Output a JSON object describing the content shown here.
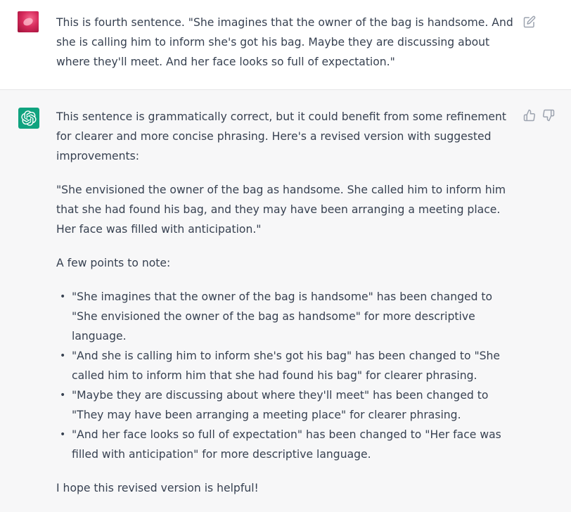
{
  "user_message": {
    "text": "This is fourth sentence. \"She imagines that the owner of the bag is handsome. And she is calling him to inform she's got his bag. Maybe they are discussing about where they'll meet. And her face looks so full of expectation.\"",
    "avatar_icon": "user-avatar-image",
    "edit_icon": "edit-icon"
  },
  "assistant_message": {
    "avatar_icon": "openai-logo-icon",
    "intro": "This sentence is grammatically correct, but it could benefit from some refinement for clearer and more concise phrasing. Here's a revised version with suggested improvements:",
    "revised": "\"She envisioned the owner of the bag as handsome. She called him to inform him that she had found his bag, and they may have been arranging a meeting place. Her face was filled with anticipation.\"",
    "points_heading": "A few points to note:",
    "points": [
      "\"She imagines that the owner of the bag is handsome\" has been changed to \"She envisioned the owner of the bag as handsome\" for more descriptive language.",
      "\"And she is calling him to inform she's got his bag\" has been changed to \"She called him to inform him that she had found his bag\" for clearer phrasing.",
      "\"Maybe they are discussing about where they'll meet\" has been changed to \"They may have been arranging a meeting place\" for clearer phrasing.",
      "\"And her face looks so full of expectation\" has been changed to \"Her face was filled with anticipation\" for more descriptive language."
    ],
    "closing": "I hope this revised version is helpful!",
    "bullet_char": "•"
  },
  "colors": {
    "assistant_bg": "#f7f7f8",
    "user_bg": "#ffffff",
    "brand_green": "#10a37f",
    "text": "#374151",
    "icon": "#9ca3af"
  }
}
